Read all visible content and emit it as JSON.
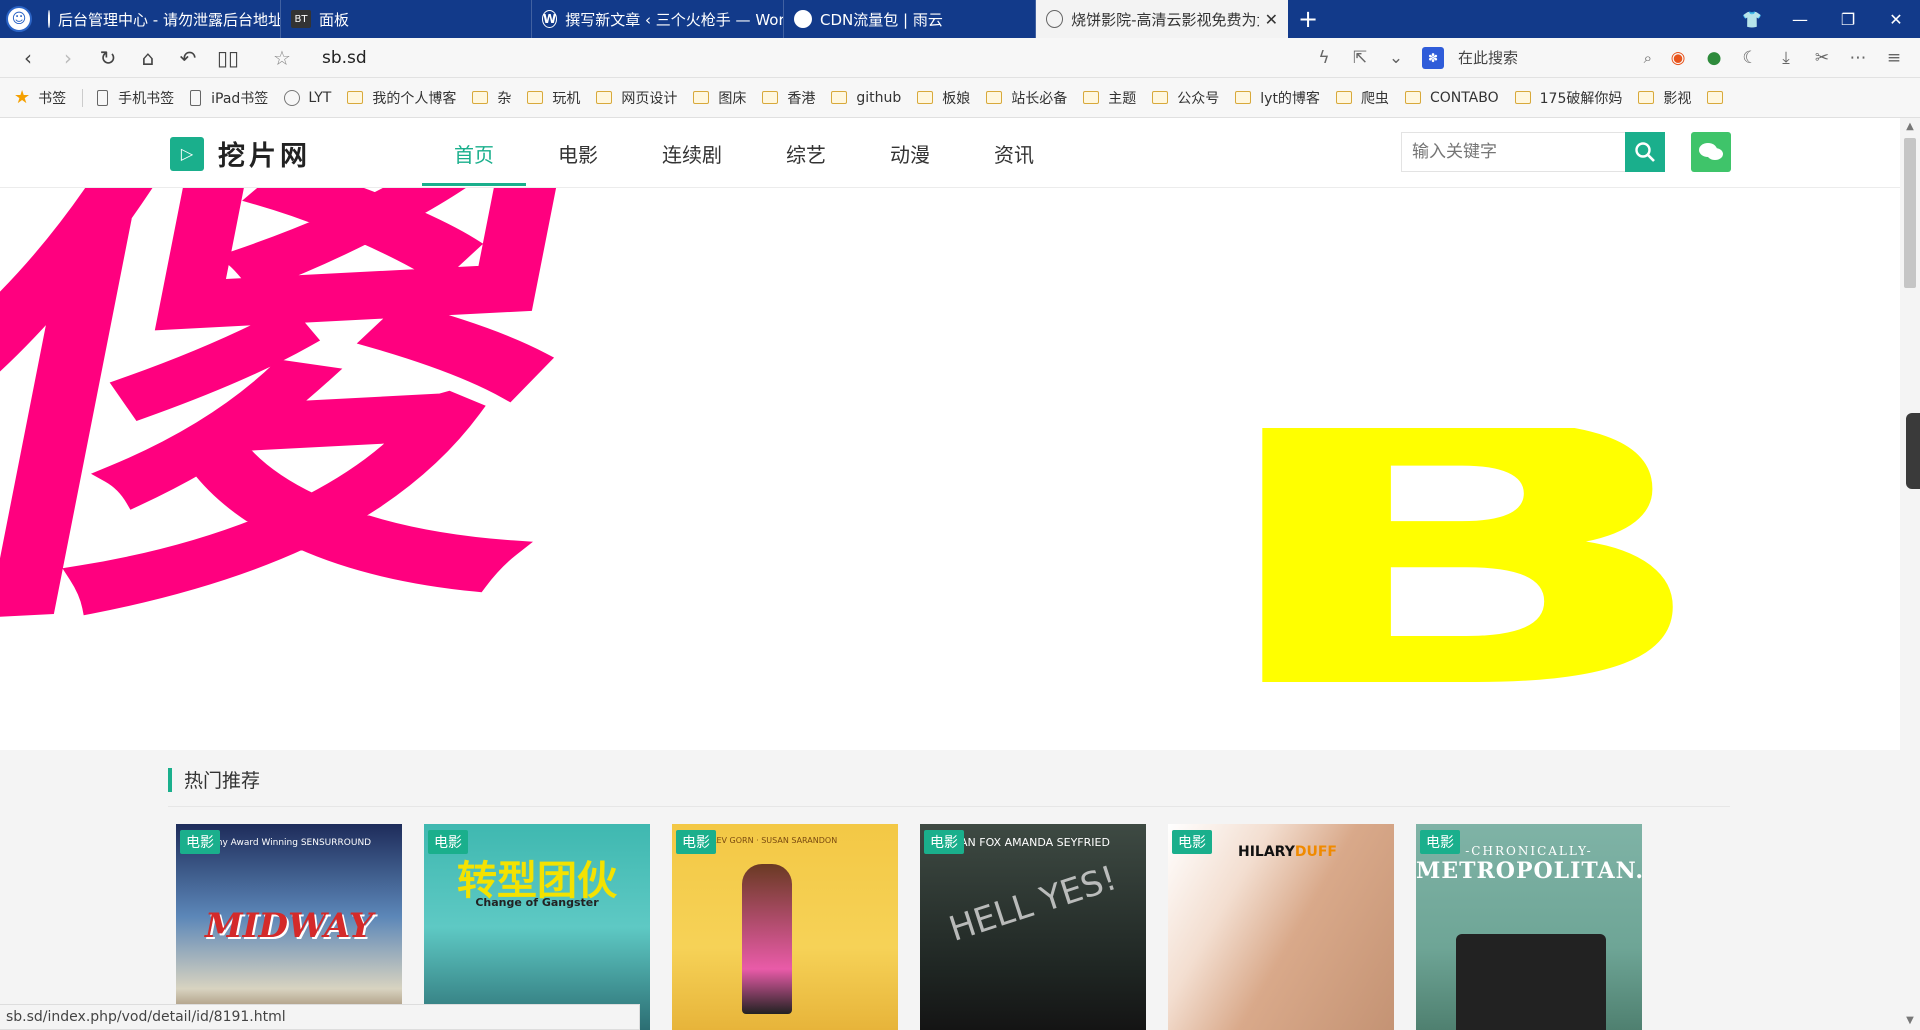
{
  "tabs": [
    {
      "label": "后台管理中心 - 请勿泄露后台地址 - (",
      "icon": "globe-icon",
      "active": false
    },
    {
      "label": "面板",
      "icon": "bt-icon",
      "icon_text": "BT",
      "active": false
    },
    {
      "label": "撰写新文章 ‹ 三个火枪手 — WordPr",
      "icon": "wordpress-icon",
      "active": false
    },
    {
      "label": "CDN流量包 | 雨云",
      "icon": "circle-icon",
      "active": false
    },
    {
      "label": "烧饼影院-高清云影视免费为大家提供",
      "icon": "globe-icon",
      "active": true
    }
  ],
  "address": {
    "url": "sb.sd",
    "search_placeholder": "在此搜索"
  },
  "bookmarks": [
    {
      "label": "书签",
      "icon": "star-icon"
    },
    {
      "label": "手机书签",
      "icon": "phone-icon"
    },
    {
      "label": "iPad书签",
      "icon": "phone-icon"
    },
    {
      "label": "LYT",
      "icon": "globe-icon"
    },
    {
      "label": "我的个人博客",
      "icon": "folder-icon"
    },
    {
      "label": "杂",
      "icon": "folder-icon"
    },
    {
      "label": "玩机",
      "icon": "folder-icon"
    },
    {
      "label": "网页设计",
      "icon": "folder-icon"
    },
    {
      "label": "图床",
      "icon": "folder-icon"
    },
    {
      "label": "香港",
      "icon": "folder-icon"
    },
    {
      "label": "github",
      "icon": "folder-icon"
    },
    {
      "label": "板娘",
      "icon": "folder-icon"
    },
    {
      "label": "站长必备",
      "icon": "folder-icon"
    },
    {
      "label": "主题",
      "icon": "folder-icon"
    },
    {
      "label": "公众号",
      "icon": "folder-icon"
    },
    {
      "label": "lyt的博客",
      "icon": "folder-icon"
    },
    {
      "label": "爬虫",
      "icon": "folder-icon"
    },
    {
      "label": "CONTABO",
      "icon": "folder-icon"
    },
    {
      "label": "175破解你妈",
      "icon": "folder-icon"
    },
    {
      "label": "影视",
      "icon": "folder-icon"
    },
    {
      "label": "",
      "icon": "folder-icon"
    }
  ],
  "site": {
    "name": "挖片网",
    "menu": [
      "首页",
      "电影",
      "连续剧",
      "综艺",
      "动漫",
      "资讯"
    ],
    "active_menu": 0,
    "search_placeholder": "输入关键字",
    "accent_color": "#1aaf8c"
  },
  "banner": {
    "left_text": "傻",
    "left_color": "#ff007f",
    "right_text": "B",
    "right_color": "#ffff00"
  },
  "hot": {
    "title": "热门推荐",
    "items": [
      {
        "tag": "电影",
        "title": "MIDWAY",
        "sub": "Academy Award Winning  SENSURROUND"
      },
      {
        "tag": "电影",
        "title": "转型团伙",
        "sub": "Change of Gangster"
      },
      {
        "tag": "电影",
        "title": "",
        "sub": "LEV GORN · SUSAN SARANDON"
      },
      {
        "tag": "电影",
        "title": "HELL YES!",
        "sub": "AN FOX  AMANDA SEYFRIED"
      },
      {
        "tag": "电影",
        "title_a": "HILARY",
        "title_b": "DUFF"
      },
      {
        "tag": "电影",
        "pre": "-CHRONICALLY-",
        "title": "METROPOLITAN."
      }
    ]
  },
  "status_url": "sb.sd/index.php/vod/detail/id/8191.html"
}
